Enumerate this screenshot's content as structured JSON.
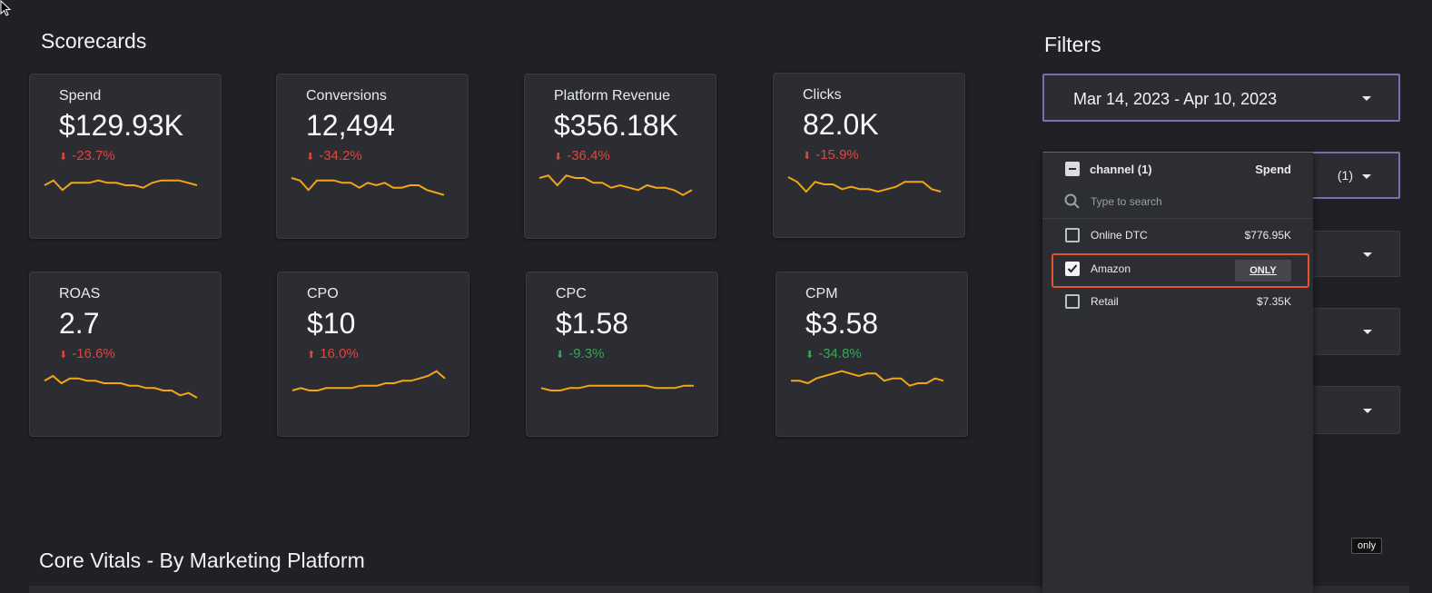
{
  "scorecards_title": "Scorecards",
  "core_vitals_title": "Core Vitals - By Marketing Platform",
  "cards": [
    {
      "label": "Spend",
      "value": "$129.93K",
      "delta": "-23.7%",
      "direction": "down",
      "sentiment": "negative"
    },
    {
      "label": "Conversions",
      "value": "12,494",
      "delta": "-34.2%",
      "direction": "down",
      "sentiment": "negative"
    },
    {
      "label": "Platform Revenue",
      "value": "$356.18K",
      "delta": "-36.4%",
      "direction": "down",
      "sentiment": "negative"
    },
    {
      "label": "Clicks",
      "value": "82.0K",
      "delta": "-15.9%",
      "direction": "down",
      "sentiment": "negative"
    },
    {
      "label": "ROAS",
      "value": "2.7",
      "delta": "-16.6%",
      "direction": "down",
      "sentiment": "negative"
    },
    {
      "label": "CPO",
      "value": "$10",
      "delta": "16.0%",
      "direction": "up",
      "sentiment": "negative"
    },
    {
      "label": "CPC",
      "value": "$1.58",
      "delta": "-9.3%",
      "direction": "down",
      "sentiment": "positive"
    },
    {
      "label": "CPM",
      "value": "$3.58",
      "delta": "-34.8%",
      "direction": "down",
      "sentiment": "positive"
    }
  ],
  "sparklines": [
    [
      6,
      8,
      4,
      7,
      7,
      7,
      8,
      7,
      7,
      6,
      6,
      5,
      7,
      8,
      8,
      8,
      7,
      6
    ],
    [
      9,
      8,
      4,
      8,
      8,
      8,
      7,
      7,
      5,
      7,
      6,
      7,
      5,
      5,
      6,
      6,
      4,
      3,
      2
    ],
    [
      9,
      10,
      6,
      10,
      9,
      9,
      7,
      7,
      5,
      6,
      5,
      4,
      6,
      5,
      5,
      4,
      2,
      4
    ],
    [
      9,
      7,
      3,
      7,
      6,
      6,
      4,
      5,
      4,
      4,
      3,
      4,
      5,
      7,
      7,
      7,
      4,
      3
    ],
    [
      7,
      9,
      6,
      8,
      8,
      7,
      7,
      6,
      6,
      6,
      5,
      5,
      4,
      4,
      3,
      3,
      1,
      2,
      0
    ],
    [
      3,
      4,
      3,
      3,
      4,
      4,
      4,
      4,
      5,
      5,
      5,
      6,
      6,
      7,
      7,
      8,
      9,
      11,
      8
    ],
    [
      4,
      3,
      3,
      4,
      4,
      5,
      5,
      5,
      5,
      5,
      5,
      5,
      4,
      4,
      4,
      5,
      5
    ],
    [
      7,
      7,
      6,
      8,
      9,
      10,
      11,
      10,
      9,
      10,
      10,
      7,
      8,
      8,
      5,
      6,
      6,
      8,
      7
    ]
  ],
  "filters": {
    "title": "Filters",
    "date_range": "Mar 14, 2023 - Apr 10, 2023",
    "channel_closed_count": "(1)",
    "dropdown": {
      "header_label": "channel (1)",
      "metric_label": "Spend",
      "search_placeholder": "Type to search",
      "options": [
        {
          "name": "Online DTC",
          "amount": "$776.95K",
          "checked": false
        },
        {
          "name": "Amazon",
          "amount": "",
          "checked": true
        },
        {
          "name": "Retail",
          "amount": "$7.35K",
          "checked": false
        }
      ],
      "only_label": "ONLY"
    }
  },
  "tooltip": "only",
  "colors": {
    "sparkline": "#f2a516",
    "negative": "#e0453d",
    "positive": "#34a853",
    "accent_border": "#7b6fb0",
    "highlight": "#e8532c"
  }
}
